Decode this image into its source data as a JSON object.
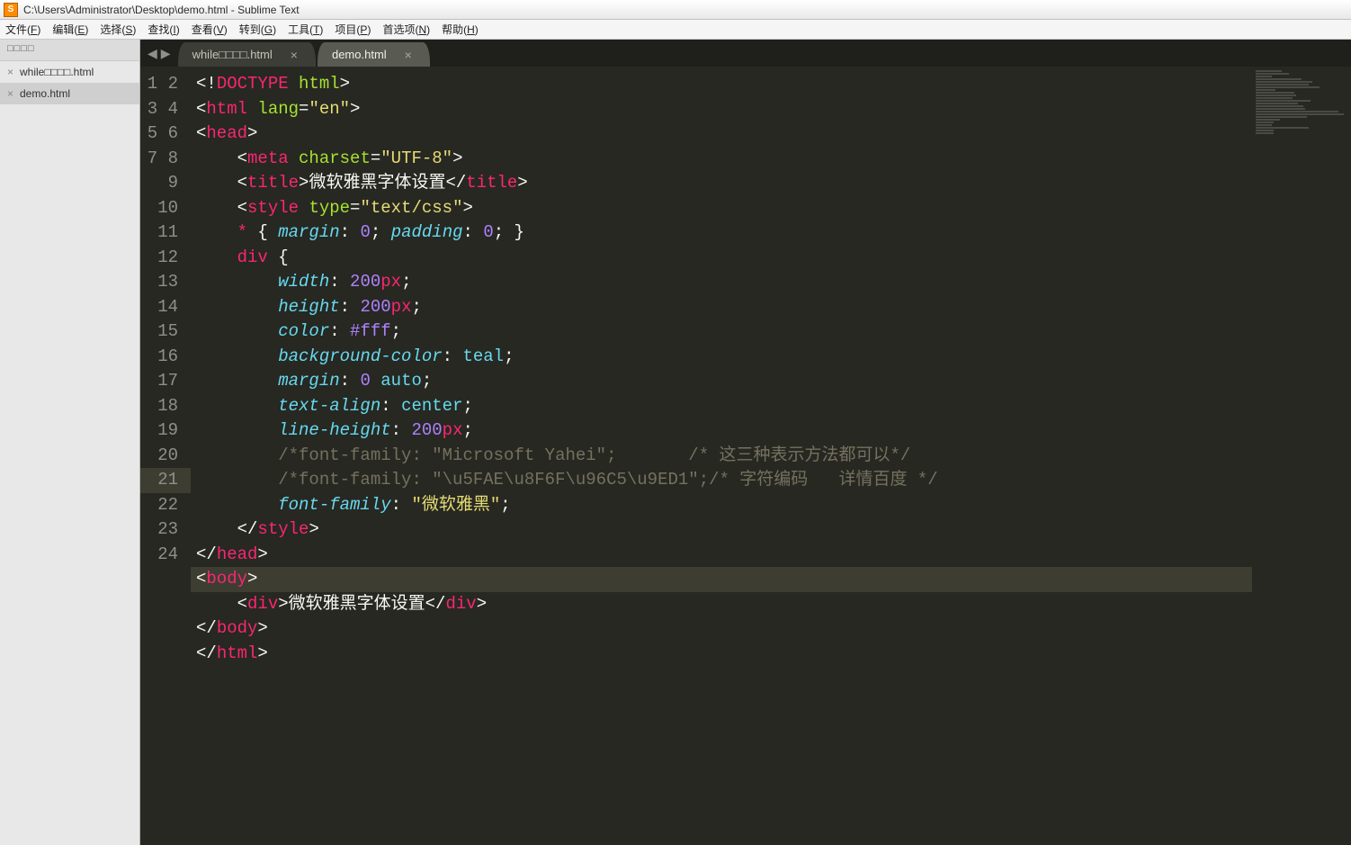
{
  "titlebar": {
    "icon_label": "S",
    "text": "C:\\Users\\Administrator\\Desktop\\demo.html - Sublime Text"
  },
  "menus": [
    {
      "label": "文件",
      "hotkey": "F"
    },
    {
      "label": "编辑",
      "hotkey": "E"
    },
    {
      "label": "选择",
      "hotkey": "S"
    },
    {
      "label": "查找",
      "hotkey": "I"
    },
    {
      "label": "查看",
      "hotkey": "V"
    },
    {
      "label": "转到",
      "hotkey": "G"
    },
    {
      "label": "工具",
      "hotkey": "T"
    },
    {
      "label": "项目",
      "hotkey": "P"
    },
    {
      "label": "首选项",
      "hotkey": "N"
    },
    {
      "label": "帮助",
      "hotkey": "H"
    }
  ],
  "sidebar": {
    "header": "□□□□",
    "items": [
      {
        "label": "while□□□□.html",
        "active": false
      },
      {
        "label": "demo.html",
        "active": true
      }
    ]
  },
  "tabs": [
    {
      "label": "while□□□□.html",
      "active": false
    },
    {
      "label": "demo.html",
      "active": true
    }
  ],
  "editor": {
    "highlighted_line": 21,
    "line_count": 24,
    "code_lines": [
      {
        "n": 1,
        "tokens": [
          [
            "<!",
            "punc"
          ],
          [
            "DOCTYPE",
            "tag"
          ],
          [
            " ",
            "punc"
          ],
          [
            "html",
            "attr"
          ],
          [
            ">",
            "punc"
          ]
        ]
      },
      {
        "n": 2,
        "tokens": [
          [
            "<",
            "punc"
          ],
          [
            "html",
            "tag"
          ],
          [
            " ",
            "punc"
          ],
          [
            "lang",
            "attr"
          ],
          [
            "=",
            "punc"
          ],
          [
            "\"en\"",
            "str"
          ],
          [
            ">",
            "punc"
          ]
        ]
      },
      {
        "n": 3,
        "tokens": [
          [
            "<",
            "punc"
          ],
          [
            "head",
            "tag"
          ],
          [
            ">",
            "punc"
          ]
        ]
      },
      {
        "n": 4,
        "tokens": [
          [
            "    <",
            "punc"
          ],
          [
            "meta",
            "tag"
          ],
          [
            " ",
            "punc"
          ],
          [
            "charset",
            "attr"
          ],
          [
            "=",
            "punc"
          ],
          [
            "\"UTF-8\"",
            "str"
          ],
          [
            ">",
            "punc"
          ]
        ]
      },
      {
        "n": 5,
        "tokens": [
          [
            "    <",
            "punc"
          ],
          [
            "title",
            "tag"
          ],
          [
            ">",
            "punc"
          ],
          [
            "微软雅黑字体设置",
            "text"
          ],
          [
            "</",
            "punc"
          ],
          [
            "title",
            "tag"
          ],
          [
            ">",
            "punc"
          ]
        ]
      },
      {
        "n": 6,
        "tokens": [
          [
            "    <",
            "punc"
          ],
          [
            "style",
            "tag"
          ],
          [
            " ",
            "punc"
          ],
          [
            "type",
            "attr"
          ],
          [
            "=",
            "punc"
          ],
          [
            "\"text/css\"",
            "str"
          ],
          [
            ">",
            "punc"
          ]
        ]
      },
      {
        "n": 7,
        "tokens": [
          [
            "    ",
            "punc"
          ],
          [
            "*",
            "sel"
          ],
          [
            " { ",
            "punc"
          ],
          [
            "margin",
            "prop"
          ],
          [
            ": ",
            "punc"
          ],
          [
            "0",
            "num"
          ],
          [
            "; ",
            "punc"
          ],
          [
            "padding",
            "prop"
          ],
          [
            ": ",
            "punc"
          ],
          [
            "0",
            "num"
          ],
          [
            "; }",
            "punc"
          ]
        ]
      },
      {
        "n": 8,
        "tokens": [
          [
            "    ",
            "punc"
          ],
          [
            "div",
            "sel"
          ],
          [
            " {",
            "punc"
          ]
        ]
      },
      {
        "n": 9,
        "tokens": [
          [
            "        ",
            "punc"
          ],
          [
            "width",
            "prop"
          ],
          [
            ": ",
            "punc"
          ],
          [
            "200",
            "num"
          ],
          [
            "px",
            "unit"
          ],
          [
            ";",
            "punc"
          ]
        ]
      },
      {
        "n": 10,
        "tokens": [
          [
            "        ",
            "punc"
          ],
          [
            "height",
            "prop"
          ],
          [
            ": ",
            "punc"
          ],
          [
            "200",
            "num"
          ],
          [
            "px",
            "unit"
          ],
          [
            ";",
            "punc"
          ]
        ]
      },
      {
        "n": 11,
        "tokens": [
          [
            "        ",
            "punc"
          ],
          [
            "color",
            "prop"
          ],
          [
            ": ",
            "punc"
          ],
          [
            "#fff",
            "num"
          ],
          [
            ";",
            "punc"
          ]
        ]
      },
      {
        "n": 12,
        "tokens": [
          [
            "        ",
            "punc"
          ],
          [
            "background-color",
            "prop"
          ],
          [
            ": ",
            "punc"
          ],
          [
            "teal",
            "val"
          ],
          [
            ";",
            "punc"
          ]
        ]
      },
      {
        "n": 13,
        "tokens": [
          [
            "        ",
            "punc"
          ],
          [
            "margin",
            "prop"
          ],
          [
            ": ",
            "punc"
          ],
          [
            "0",
            "num"
          ],
          [
            " ",
            "punc"
          ],
          [
            "auto",
            "val"
          ],
          [
            ";",
            "punc"
          ]
        ]
      },
      {
        "n": 14,
        "tokens": [
          [
            "        ",
            "punc"
          ],
          [
            "text-align",
            "prop"
          ],
          [
            ": ",
            "punc"
          ],
          [
            "center",
            "val"
          ],
          [
            ";",
            "punc"
          ]
        ]
      },
      {
        "n": 15,
        "tokens": [
          [
            "        ",
            "punc"
          ],
          [
            "line-height",
            "prop"
          ],
          [
            ": ",
            "punc"
          ],
          [
            "200",
            "num"
          ],
          [
            "px",
            "unit"
          ],
          [
            ";",
            "punc"
          ]
        ]
      },
      {
        "n": 16,
        "tokens": [
          [
            "        ",
            "punc"
          ],
          [
            "/*font-family: \"Microsoft Yahei\";       /* 这三种表示方法都可以*/",
            "cmt"
          ]
        ]
      },
      {
        "n": 17,
        "tokens": [
          [
            "        ",
            "punc"
          ],
          [
            "/*font-family: \"\\u5FAE\\u8F6F\\u96C5\\u9ED1\";/* 字符编码   详情百度 */",
            "cmt"
          ]
        ]
      },
      {
        "n": 18,
        "tokens": [
          [
            "        ",
            "punc"
          ],
          [
            "font-family",
            "prop"
          ],
          [
            ": ",
            "punc"
          ],
          [
            "\"微软雅黑\"",
            "str"
          ],
          [
            ";",
            "punc"
          ]
        ]
      },
      {
        "n": 19,
        "tokens": [
          [
            "    </",
            "punc"
          ],
          [
            "style",
            "tag"
          ],
          [
            ">",
            "punc"
          ]
        ]
      },
      {
        "n": 20,
        "tokens": [
          [
            "</",
            "punc"
          ],
          [
            "head",
            "tag"
          ],
          [
            ">",
            "punc"
          ]
        ]
      },
      {
        "n": 21,
        "tokens": [
          [
            "<",
            "punc"
          ],
          [
            "body",
            "tag"
          ],
          [
            ">",
            "punc"
          ]
        ]
      },
      {
        "n": 22,
        "tokens": [
          [
            "    <",
            "punc"
          ],
          [
            "div",
            "tag"
          ],
          [
            ">",
            "punc"
          ],
          [
            "微软雅黑字体设置",
            "text"
          ],
          [
            "</",
            "punc"
          ],
          [
            "div",
            "tag"
          ],
          [
            ">",
            "punc"
          ]
        ]
      },
      {
        "n": 23,
        "tokens": [
          [
            "</",
            "punc"
          ],
          [
            "body",
            "tag"
          ],
          [
            ">",
            "punc"
          ]
        ]
      },
      {
        "n": 24,
        "tokens": [
          [
            "</",
            "punc"
          ],
          [
            "html",
            "tag"
          ],
          [
            ">",
            "punc"
          ]
        ]
      }
    ]
  }
}
